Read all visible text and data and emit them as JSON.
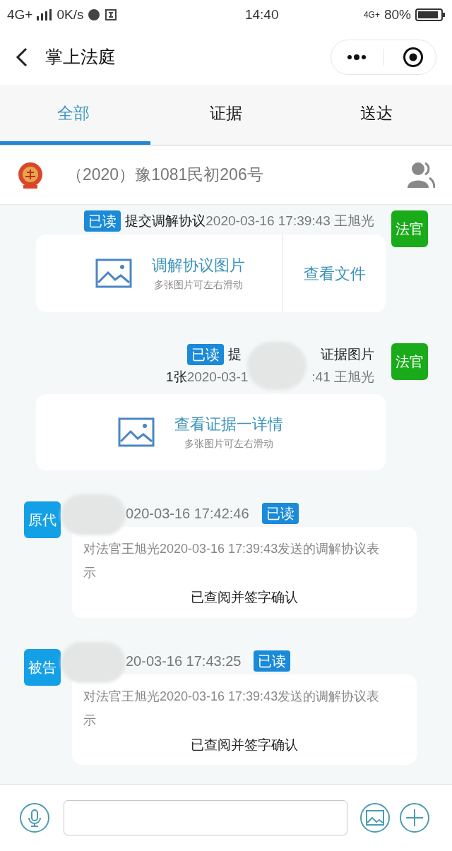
{
  "status_bar": {
    "network": "4G+",
    "speed": "0K/s",
    "time": "14:40",
    "network_right": "4G+",
    "battery": "80%"
  },
  "nav": {
    "title": "掌上法庭"
  },
  "tabs": [
    {
      "label": "全部",
      "selected": true
    },
    {
      "label": "证据",
      "selected": false
    },
    {
      "label": "送达",
      "selected": false
    }
  ],
  "case": {
    "number": "（2020）豫1081民初206号"
  },
  "messages": [
    {
      "kind": "file",
      "sender": "法官",
      "read_label": "已读",
      "text": "提交调解协议",
      "meta": "2020-03-16 17:39:43 王旭光",
      "card_title": "调解协议图片",
      "card_hint": "多张图片可左右滑动",
      "action": "查看文件"
    },
    {
      "kind": "evidence",
      "sender": "法官",
      "read_label": "已读",
      "text": "提",
      "text_end": "证据图片",
      "meta_start": "1张2020-03-1",
      "meta_end": ":41 王旭光",
      "card_title": "查看证据一详情",
      "card_hint": "多张图片可左右滑动"
    },
    {
      "kind": "confirm",
      "sender": "原代",
      "meta": "020-03-16 17:42:46",
      "read_label": "已读",
      "body": "对法官王旭光2020-03-16 17:39:43发送的调解协议表示",
      "action": "已查阅并签字确认"
    },
    {
      "kind": "confirm",
      "sender": "被告",
      "meta": "20-03-16 17:43:25",
      "read_label": "已读",
      "body": "对法官王旭光2020-03-16 17:39:43发送的调解协议表示",
      "action": "已查阅并签字确认"
    }
  ]
}
